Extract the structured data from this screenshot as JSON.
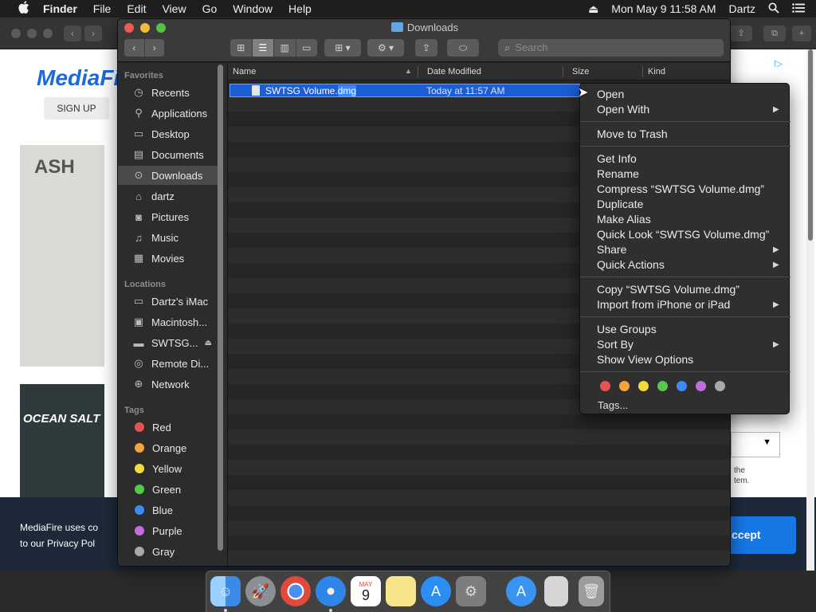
{
  "menubar": {
    "apple": "",
    "app_name": "Finder",
    "menus": [
      "File",
      "Edit",
      "View",
      "Go",
      "Window",
      "Help"
    ],
    "clock": "Mon May 9  11:58 AM",
    "user": "Dartz"
  },
  "browser": {
    "logo": "MediaFire",
    "signup": "SIGN UP",
    "ad_text": "ASH",
    "ad2_text": "OCEAN SALT",
    "cookie_line1": "MediaFire uses co",
    "cookie_line2": "to our Privacy Pol",
    "accept_label": "ccept",
    "right_text_line1": "the",
    "right_text_line2": "tem."
  },
  "finder": {
    "title": "Downloads",
    "search_placeholder": "Search",
    "sidebar": {
      "favorites_label": "Favorites",
      "favorites": [
        {
          "label": "Recents",
          "icon": "clock-icon"
        },
        {
          "label": "Applications",
          "icon": "applications-icon"
        },
        {
          "label": "Desktop",
          "icon": "desktop-icon"
        },
        {
          "label": "Documents",
          "icon": "document-icon"
        },
        {
          "label": "Downloads",
          "icon": "download-icon"
        },
        {
          "label": "dartz",
          "icon": "home-icon"
        },
        {
          "label": "Pictures",
          "icon": "camera-icon"
        },
        {
          "label": "Music",
          "icon": "music-icon"
        },
        {
          "label": "Movies",
          "icon": "film-icon"
        }
      ],
      "locations_label": "Locations",
      "locations": [
        {
          "label": "Dartz's iMac",
          "icon": "imac-icon"
        },
        {
          "label": "Macintosh...",
          "icon": "drive-icon"
        },
        {
          "label": "SWTSG...",
          "icon": "disk-image-icon"
        },
        {
          "label": "Remote Di...",
          "icon": "remote-disc-icon"
        },
        {
          "label": "Network",
          "icon": "network-icon"
        }
      ],
      "tags_label": "Tags",
      "tags": [
        {
          "label": "Red",
          "color": "#e9534d"
        },
        {
          "label": "Orange",
          "color": "#f5a33c"
        },
        {
          "label": "Yellow",
          "color": "#f6d93b"
        },
        {
          "label": "Green",
          "color": "#55c94b"
        },
        {
          "label": "Blue",
          "color": "#3b8cf5"
        },
        {
          "label": "Purple",
          "color": "#c16de0"
        },
        {
          "label": "Gray",
          "color": "#a9a9a9"
        }
      ]
    },
    "columns": [
      "Name",
      "Date Modified",
      "Size",
      "Kind"
    ],
    "file": {
      "name_base": "SWTSG Volume.",
      "name_ext": "dmg",
      "date_modified": "Today at 11:57 AM"
    }
  },
  "context_menu": {
    "items": [
      {
        "label": "Open",
        "submenu": false
      },
      {
        "label": "Open With",
        "submenu": true
      },
      {
        "label": "Move to Trash",
        "submenu": false
      },
      {
        "label": "Get Info",
        "submenu": false
      },
      {
        "label": "Rename",
        "submenu": false
      },
      {
        "label": "Compress “SWTSG Volume.dmg”",
        "submenu": false
      },
      {
        "label": "Duplicate",
        "submenu": false
      },
      {
        "label": "Make Alias",
        "submenu": false
      },
      {
        "label": "Quick Look “SWTSG Volume.dmg”",
        "submenu": false
      },
      {
        "label": "Share",
        "submenu": true
      },
      {
        "label": "Quick Actions",
        "submenu": true
      },
      {
        "label": "Copy “SWTSG Volume.dmg”",
        "submenu": false
      },
      {
        "label": "Import from iPhone or iPad",
        "submenu": true
      },
      {
        "label": "Use Groups",
        "submenu": false
      },
      {
        "label": "Sort By",
        "submenu": true
      },
      {
        "label": "Show View Options",
        "submenu": false
      }
    ],
    "tag_colors": [
      "#e9534d",
      "#f5a33c",
      "#f6d93b",
      "#55c94b",
      "#3b8cf5",
      "#c16de0",
      "#a9a9a9"
    ],
    "tags_label": "Tags..."
  },
  "dock": {
    "calendar_month": "MAY",
    "calendar_day": "9",
    "apps": [
      {
        "name": "finder-icon",
        "color": "#4fa3f0"
      },
      {
        "name": "launchpad-icon",
        "color": "#8a8f96"
      },
      {
        "name": "chrome-icon",
        "color": "#e6e6e6"
      },
      {
        "name": "safari-icon",
        "color": "#3b8ee8"
      },
      {
        "name": "calendar-icon",
        "color": "#ffffff"
      },
      {
        "name": "notes-icon",
        "color": "#f8e58a"
      },
      {
        "name": "app-store-icon",
        "color": "#2b8ef2"
      },
      {
        "name": "system-preferences-icon",
        "color": "#7d7d7d"
      },
      {
        "name": "app-store-folder-icon",
        "color": "#3a93f0"
      },
      {
        "name": "dmg-file-icon",
        "color": "#d6d6d6"
      },
      {
        "name": "trash-icon",
        "color": "#9c9c9c"
      }
    ]
  }
}
